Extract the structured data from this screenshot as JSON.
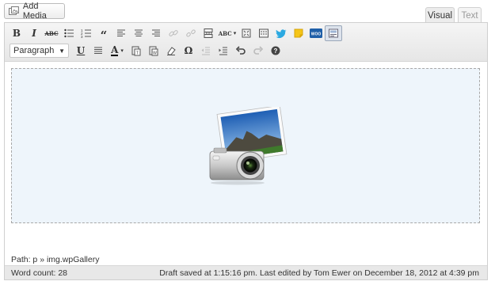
{
  "add_media": {
    "label": "Add Media"
  },
  "tabs": {
    "visual": "Visual",
    "text": "Text"
  },
  "toolbar": {
    "row1": [
      {
        "name": "bold",
        "glyph": "B"
      },
      {
        "name": "italic",
        "glyph": "I"
      },
      {
        "name": "strikethrough",
        "glyph": "ABC"
      },
      {
        "name": "bullet-list",
        "glyph": ""
      },
      {
        "name": "numbered-list",
        "glyph": ""
      },
      {
        "name": "blockquote",
        "glyph": "“"
      },
      {
        "name": "align-left",
        "glyph": ""
      },
      {
        "name": "align-center",
        "glyph": ""
      },
      {
        "name": "align-right",
        "glyph": ""
      },
      {
        "name": "insert-link",
        "glyph": ""
      },
      {
        "name": "unlink",
        "glyph": ""
      },
      {
        "name": "insert-more",
        "glyph": ""
      },
      {
        "name": "spellcheck",
        "glyph": "ABC"
      },
      {
        "name": "fullscreen",
        "glyph": ""
      },
      {
        "name": "toggle-kitchen-sink",
        "glyph": ""
      },
      {
        "name": "twitter",
        "glyph": ""
      },
      {
        "name": "sticky-note",
        "glyph": ""
      },
      {
        "name": "woo-shortcodes",
        "glyph": "WOO"
      },
      {
        "name": "gallery-settings",
        "glyph": ""
      }
    ],
    "format_select": {
      "value": "Paragraph"
    },
    "row2": [
      {
        "name": "underline",
        "glyph": "U"
      },
      {
        "name": "justify",
        "glyph": ""
      },
      {
        "name": "text-color",
        "glyph": "A"
      },
      {
        "name": "paste-text",
        "glyph": ""
      },
      {
        "name": "paste-word",
        "glyph": ""
      },
      {
        "name": "remove-format",
        "glyph": ""
      },
      {
        "name": "special-character",
        "glyph": "Ω"
      },
      {
        "name": "outdent",
        "glyph": ""
      },
      {
        "name": "indent",
        "glyph": ""
      },
      {
        "name": "undo",
        "glyph": ""
      },
      {
        "name": "redo",
        "glyph": ""
      },
      {
        "name": "help",
        "glyph": "?"
      }
    ]
  },
  "content": {
    "gallery_icon": "camera-photo-icon"
  },
  "path": {
    "label": "Path: p » img.wpGallery"
  },
  "status": {
    "word_count": "Word count: 28",
    "draft": "Draft saved at 1:15:16 pm. Last edited by Tom Ewer on December 18, 2012 at 4:39 pm"
  },
  "colors": {
    "gallery_bg": "#eef5fb",
    "toolbar_bg": "#ececec",
    "twitter": "#1da1f2",
    "woo": "#1f5fa8"
  }
}
